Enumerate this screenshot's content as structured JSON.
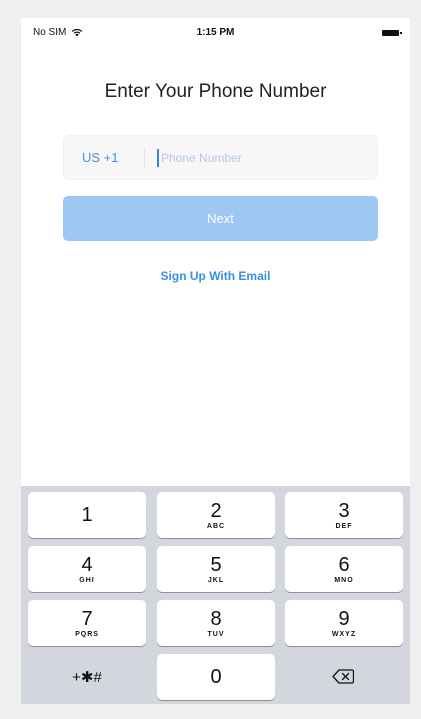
{
  "status_bar": {
    "carrier": "No SIM",
    "time": "1:15 PM"
  },
  "title": "Enter Your Phone Number",
  "phone_input": {
    "country_code": "US +1",
    "placeholder": "Phone Number",
    "value": ""
  },
  "next_button": {
    "label": "Next"
  },
  "email_link": {
    "label": "Sign Up With Email"
  },
  "keypad": {
    "keys": [
      {
        "digit": "1",
        "letters": ""
      },
      {
        "digit": "2",
        "letters": "ABC"
      },
      {
        "digit": "3",
        "letters": "DEF"
      },
      {
        "digit": "4",
        "letters": "GHI"
      },
      {
        "digit": "5",
        "letters": "JKL"
      },
      {
        "digit": "6",
        "letters": "MNO"
      },
      {
        "digit": "7",
        "letters": "PQRS"
      },
      {
        "digit": "8",
        "letters": "TUV"
      },
      {
        "digit": "9",
        "letters": "WXYZ"
      },
      {
        "digit": "0",
        "letters": ""
      }
    ],
    "symbols_label": "+✱#"
  },
  "colors": {
    "accent": "#3a8ee6",
    "button_disabled": "#9ec8f3",
    "keypad_bg": "#d3d6dc"
  }
}
